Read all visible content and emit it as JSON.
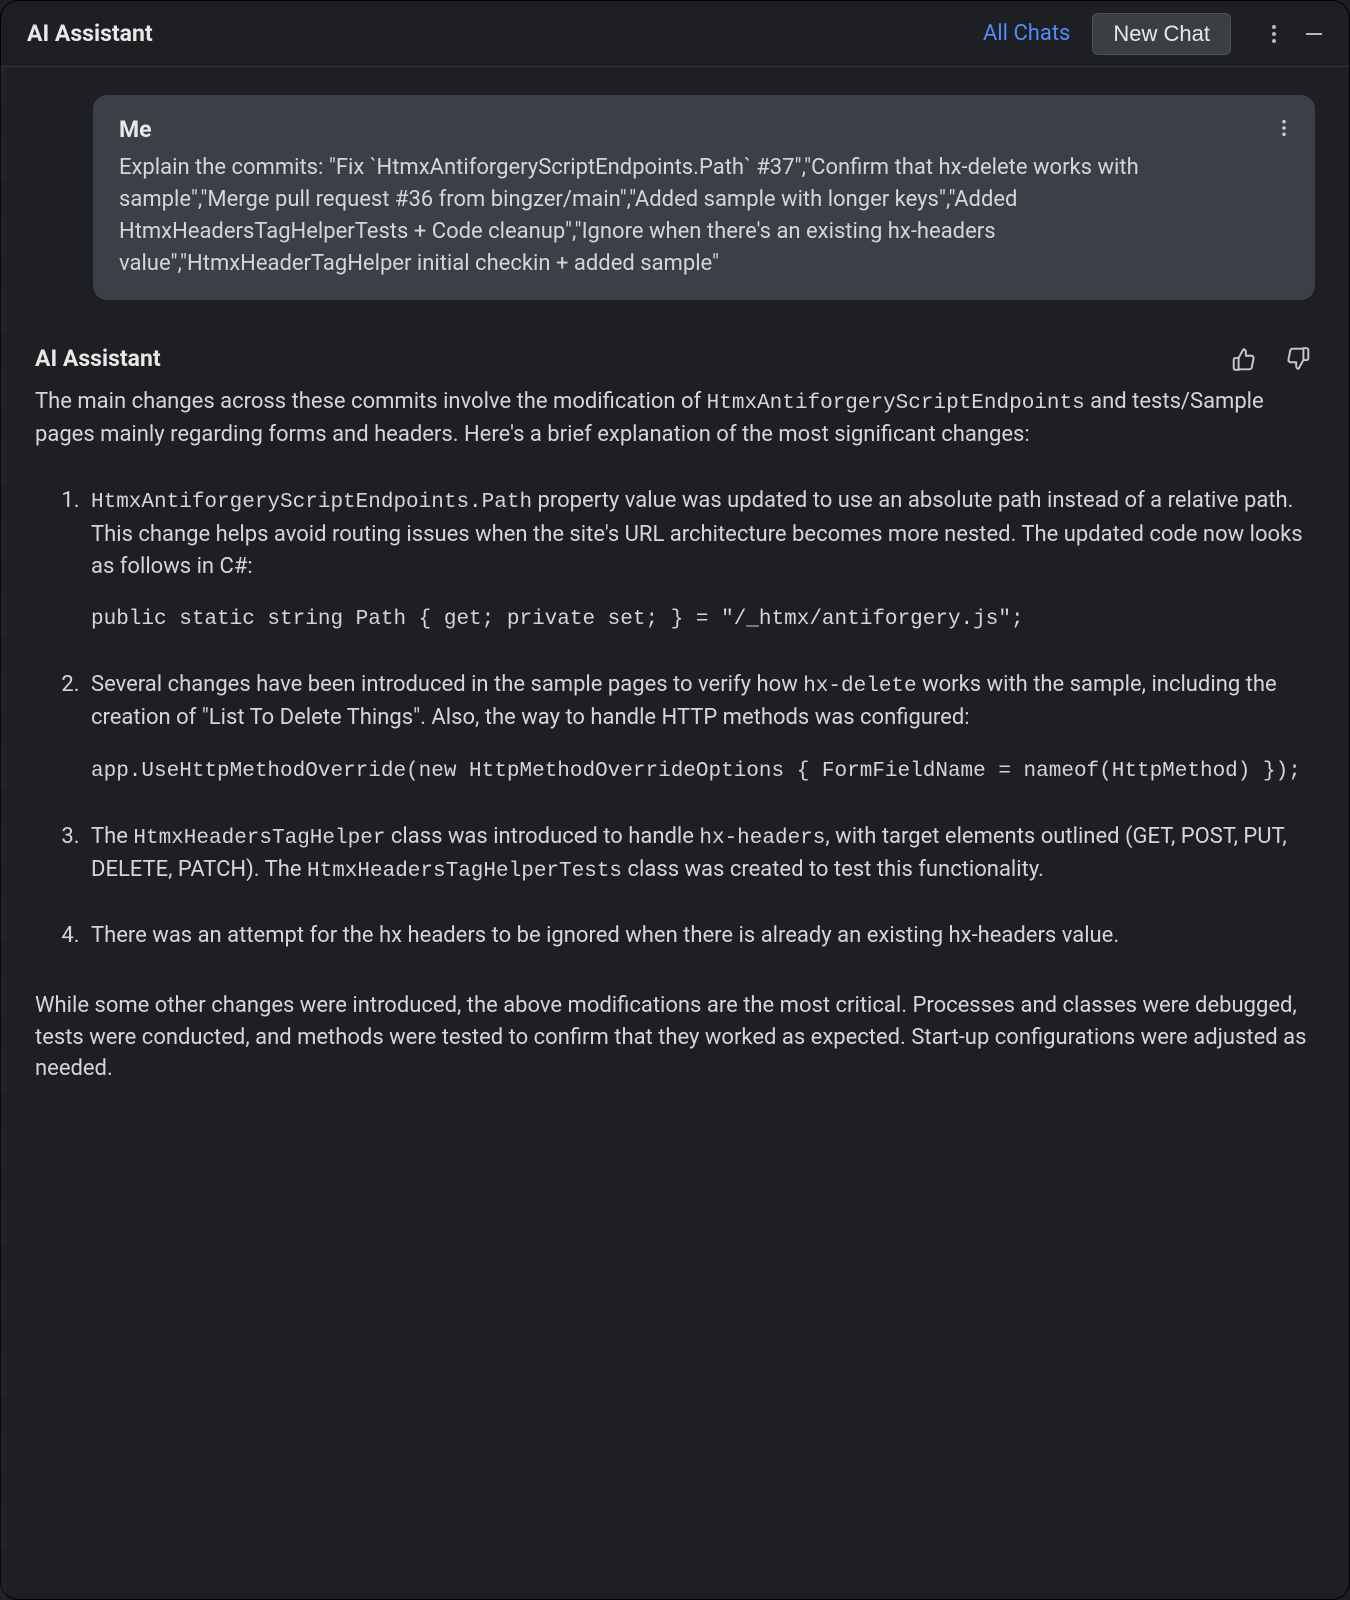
{
  "header": {
    "title": "AI Assistant",
    "all_chats_label": "All Chats",
    "new_chat_label": "New Chat"
  },
  "user_message": {
    "sender": "Me",
    "content_parts": [
      "Explain the commits: \"Fix `HtmxAntiforgeryScriptEndpoints.Path` #37\",\"Confirm that hx-delete works with sample\",\"Merge pull request #36 from bingzer/main\",\"Added sample with longer keys\",\"Added HtmxHeadersTagHelperTests + Code cleanup\",\"Ignore when there's an existing hx-headers value\",\"HtmxHeaderTagHelper initial checkin + added sample\""
    ]
  },
  "assistant_message": {
    "sender": "AI Assistant",
    "intro_pre": "The main changes across these commits involve the modification of ",
    "intro_code": "HtmxAntiforgeryScriptEndpoints",
    "intro_post": " and tests/Sample pages mainly regarding forms and headers. Here's a brief explanation of the most significant changes:",
    "items": [
      {
        "pre_code": "HtmxAntiforgeryScriptEndpoints.Path",
        "rest": " property value was updated to use an absolute path instead of a relative path. This change helps avoid routing issues when the site's URL architecture becomes more nested. The updated code now looks as follows in C#:",
        "codeblock": "public static string Path { get; private set; } = \"/_htmx/antiforgery.js\";"
      },
      {
        "text_a": "Several changes have been introduced in the sample pages to verify how ",
        "inline_code_a": "hx-delete",
        "text_b": " works with the sample, including the creation of \"List To Delete Things\". Also, the way to handle HTTP methods was configured:",
        "codeblock": "app.UseHttpMethodOverride(new HttpMethodOverrideOptions { FormFieldName = nameof(HttpMethod) });"
      },
      {
        "text_a": "The ",
        "inline_code_a": "HtmxHeadersTagHelper",
        "text_b": " class was introduced to handle ",
        "inline_code_b": "hx-headers",
        "text_c": ", with target elements outlined (GET, POST, PUT, DELETE, PATCH). The ",
        "inline_code_c": "HtmxHeadersTagHelperTests",
        "text_d": " class was created to test this functionality."
      },
      {
        "text_a": "There was an attempt for the hx headers to be ignored when there is already an existing hx-headers value."
      }
    ],
    "closing": "While some other changes were introduced, the above modifications are the most critical. Processes and classes were debugged, tests were conducted, and methods were tested to confirm that they worked as expected. Start-up configurations were adjusted as needed."
  },
  "icons": {
    "more_vertical": "more-vertical-icon",
    "minimize": "minimize-icon",
    "thumbs_up": "thumbs-up-icon",
    "thumbs_down": "thumbs-down-icon"
  }
}
